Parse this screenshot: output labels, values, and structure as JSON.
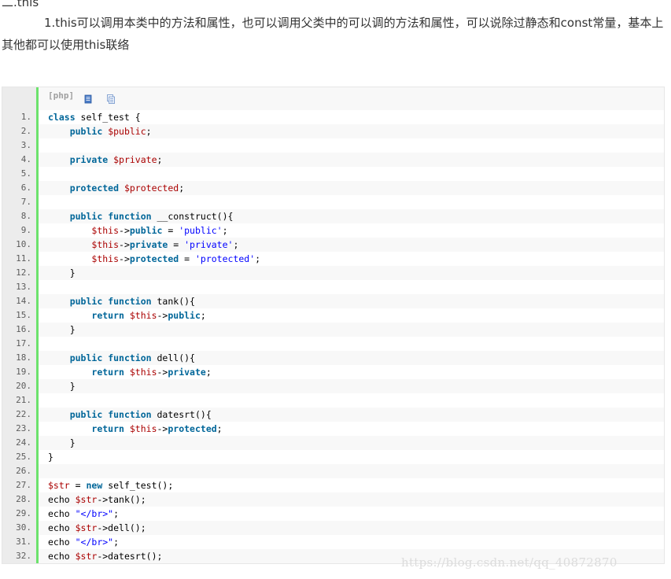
{
  "article": {
    "heading": "二.this",
    "paragraph": "1.this可以调用本类中的方法和属性，也可以调用父类中的可以调的方法和属性，可以说除过静态和const常量，基本上其他都可以使用this联络"
  },
  "code_block": {
    "language_label": "[php]",
    "toolbar_icons": [
      "view-source-icon",
      "copy-icon"
    ],
    "colors": {
      "keyword": "#006699",
      "variable": "#aa0000",
      "string": "#0000ff",
      "gutter_bar": "#6ce26c"
    },
    "lines": [
      {
        "n": "1.",
        "tokens": [
          [
            "kw",
            "class"
          ],
          [
            "pl",
            " self_test {"
          ]
        ]
      },
      {
        "n": "2.",
        "tokens": [
          [
            "pl",
            "    "
          ],
          [
            "kw",
            "public"
          ],
          [
            "pl",
            " "
          ],
          [
            "var",
            "$public"
          ],
          [
            "pl",
            ";"
          ]
        ]
      },
      {
        "n": "3.",
        "tokens": []
      },
      {
        "n": "4.",
        "tokens": [
          [
            "pl",
            "    "
          ],
          [
            "kw",
            "private"
          ],
          [
            "pl",
            " "
          ],
          [
            "var",
            "$private"
          ],
          [
            "pl",
            ";"
          ]
        ]
      },
      {
        "n": "5.",
        "tokens": []
      },
      {
        "n": "6.",
        "tokens": [
          [
            "pl",
            "    "
          ],
          [
            "kw",
            "protected"
          ],
          [
            "pl",
            " "
          ],
          [
            "var",
            "$protected"
          ],
          [
            "pl",
            ";"
          ]
        ]
      },
      {
        "n": "7.",
        "tokens": []
      },
      {
        "n": "8.",
        "tokens": [
          [
            "pl",
            "    "
          ],
          [
            "kw",
            "public"
          ],
          [
            "pl",
            " "
          ],
          [
            "kw",
            "function"
          ],
          [
            "pl",
            " __construct(){"
          ]
        ]
      },
      {
        "n": "9.",
        "tokens": [
          [
            "pl",
            "        "
          ],
          [
            "var",
            "$this"
          ],
          [
            "pl",
            "->"
          ],
          [
            "kw",
            "public"
          ],
          [
            "pl",
            " = "
          ],
          [
            "str",
            "'public'"
          ],
          [
            "pl",
            ";"
          ]
        ]
      },
      {
        "n": "10.",
        "tokens": [
          [
            "pl",
            "        "
          ],
          [
            "var",
            "$this"
          ],
          [
            "pl",
            "->"
          ],
          [
            "kw",
            "private"
          ],
          [
            "pl",
            " = "
          ],
          [
            "str",
            "'private'"
          ],
          [
            "pl",
            ";"
          ]
        ]
      },
      {
        "n": "11.",
        "tokens": [
          [
            "pl",
            "        "
          ],
          [
            "var",
            "$this"
          ],
          [
            "pl",
            "->"
          ],
          [
            "kw",
            "protected"
          ],
          [
            "pl",
            " = "
          ],
          [
            "str",
            "'protected'"
          ],
          [
            "pl",
            ";"
          ]
        ]
      },
      {
        "n": "12.",
        "tokens": [
          [
            "pl",
            "    }"
          ]
        ]
      },
      {
        "n": "13.",
        "tokens": []
      },
      {
        "n": "14.",
        "tokens": [
          [
            "pl",
            "    "
          ],
          [
            "kw",
            "public"
          ],
          [
            "pl",
            " "
          ],
          [
            "kw",
            "function"
          ],
          [
            "pl",
            " tank(){"
          ]
        ]
      },
      {
        "n": "15.",
        "tokens": [
          [
            "pl",
            "        "
          ],
          [
            "kw",
            "return"
          ],
          [
            "pl",
            " "
          ],
          [
            "var",
            "$this"
          ],
          [
            "pl",
            "->"
          ],
          [
            "kw",
            "public"
          ],
          [
            "pl",
            ";"
          ]
        ]
      },
      {
        "n": "16.",
        "tokens": [
          [
            "pl",
            "    }"
          ]
        ]
      },
      {
        "n": "17.",
        "tokens": []
      },
      {
        "n": "18.",
        "tokens": [
          [
            "pl",
            "    "
          ],
          [
            "kw",
            "public"
          ],
          [
            "pl",
            " "
          ],
          [
            "kw",
            "function"
          ],
          [
            "pl",
            " dell(){"
          ]
        ]
      },
      {
        "n": "19.",
        "tokens": [
          [
            "pl",
            "        "
          ],
          [
            "kw",
            "return"
          ],
          [
            "pl",
            " "
          ],
          [
            "var",
            "$this"
          ],
          [
            "pl",
            "->"
          ],
          [
            "kw",
            "private"
          ],
          [
            "pl",
            ";"
          ]
        ]
      },
      {
        "n": "20.",
        "tokens": [
          [
            "pl",
            "    }"
          ]
        ]
      },
      {
        "n": "21.",
        "tokens": []
      },
      {
        "n": "22.",
        "tokens": [
          [
            "pl",
            "    "
          ],
          [
            "kw",
            "public"
          ],
          [
            "pl",
            " "
          ],
          [
            "kw",
            "function"
          ],
          [
            "pl",
            " datesrt(){"
          ]
        ]
      },
      {
        "n": "23.",
        "tokens": [
          [
            "pl",
            "        "
          ],
          [
            "kw",
            "return"
          ],
          [
            "pl",
            " "
          ],
          [
            "var",
            "$this"
          ],
          [
            "pl",
            "->"
          ],
          [
            "kw",
            "protected"
          ],
          [
            "pl",
            ";"
          ]
        ]
      },
      {
        "n": "24.",
        "tokens": [
          [
            "pl",
            "    }"
          ]
        ]
      },
      {
        "n": "25.",
        "tokens": [
          [
            "pl",
            "}"
          ]
        ]
      },
      {
        "n": "26.",
        "tokens": []
      },
      {
        "n": "27.",
        "tokens": [
          [
            "var",
            "$str"
          ],
          [
            "pl",
            " = "
          ],
          [
            "kw",
            "new"
          ],
          [
            "pl",
            " self_test();"
          ]
        ]
      },
      {
        "n": "28.",
        "tokens": [
          [
            "pl",
            "echo "
          ],
          [
            "var",
            "$str"
          ],
          [
            "pl",
            "->tank();"
          ]
        ]
      },
      {
        "n": "29.",
        "tokens": [
          [
            "pl",
            "echo "
          ],
          [
            "str",
            "\"</br>\""
          ],
          [
            "pl",
            ";"
          ]
        ]
      },
      {
        "n": "30.",
        "tokens": [
          [
            "pl",
            "echo "
          ],
          [
            "var",
            "$str"
          ],
          [
            "pl",
            "->dell();"
          ]
        ]
      },
      {
        "n": "31.",
        "tokens": [
          [
            "pl",
            "echo "
          ],
          [
            "str",
            "\"</br>\""
          ],
          [
            "pl",
            ";"
          ]
        ]
      },
      {
        "n": "32.",
        "tokens": [
          [
            "pl",
            "echo "
          ],
          [
            "var",
            "$str"
          ],
          [
            "pl",
            "->datesrt();"
          ]
        ]
      }
    ]
  },
  "watermark": "https://blog.csdn.net/qq_40872870"
}
